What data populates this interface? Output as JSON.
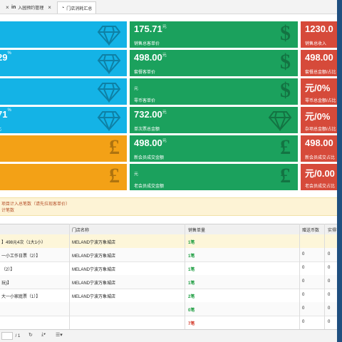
{
  "tabs": [
    {
      "label": "",
      "icon": "x"
    },
    {
      "label": "入园预约管理",
      "icon": "in"
    },
    {
      "label": "门店消耗汇总",
      "icon": "◔"
    }
  ],
  "cards": [
    {
      "color": "blue",
      "value": "",
      "sup": "",
      "unit": "",
      "label": "",
      "icon": "diamond-icon"
    },
    {
      "color": "green",
      "value": "175.71",
      "sup": "元",
      "unit": "",
      "label": "销售总客单价",
      "icon": "dollar-icon"
    },
    {
      "color": "red",
      "value": "1230.0",
      "sup": "",
      "unit": "",
      "label": "销售总收入",
      "icon": ""
    },
    {
      "color": "blue",
      "value": "29",
      "sup": "%",
      "unit": "",
      "label": "",
      "icon": "diamond-icon"
    },
    {
      "color": "green",
      "value": "498.00",
      "sup": "元",
      "unit": "",
      "label": "套餐客单价",
      "icon": "dollar-icon"
    },
    {
      "color": "red",
      "value": "498.00",
      "sup": "",
      "unit": "",
      "label": "套餐总金额/占比",
      "icon": ""
    },
    {
      "color": "blue",
      "value": "",
      "sup": "",
      "unit": "",
      "label": "",
      "icon": "diamond-icon"
    },
    {
      "color": "green",
      "value": "",
      "sup": "",
      "unit": "元",
      "label": "零币客单价",
      "icon": "dollar-icon"
    },
    {
      "color": "red",
      "value": "元/0%",
      "sup": "",
      "unit": "",
      "label": "零币总金额/占比",
      "icon": ""
    },
    {
      "color": "blue",
      "value": "71",
      "sup": "%",
      "unit": "",
      "label": "比",
      "icon": "diamond-icon"
    },
    {
      "color": "green",
      "value": "732.00",
      "sup": "元",
      "unit": "",
      "label": "单次票总金额",
      "icon": "diamond-icon"
    },
    {
      "color": "red",
      "value": "元/0%",
      "sup": "",
      "unit": "",
      "label": "杂项总金额/占比",
      "icon": ""
    },
    {
      "color": "orange",
      "value": "",
      "sup": "",
      "unit": "",
      "label": "",
      "icon": "pound-icon"
    },
    {
      "color": "green",
      "value": "498.00",
      "sup": "元",
      "unit": "",
      "label": "新会员成交金额",
      "icon": "pound-icon"
    },
    {
      "color": "red",
      "value": "498.00",
      "sup": "",
      "unit": "",
      "label": "新会员成交占比",
      "icon": ""
    },
    {
      "color": "orange",
      "value": "",
      "sup": "",
      "unit": "",
      "label": "",
      "icon": "pound-icon"
    },
    {
      "color": "green",
      "value": "",
      "sup": "",
      "unit": "元",
      "label": "老会员成交金额",
      "icon": "pound-icon"
    },
    {
      "color": "red",
      "value": "元/0.00",
      "sup": "",
      "unit": "",
      "label": "老会员成交占比",
      "icon": ""
    }
  ],
  "notice": {
    "line1": "项目计入总笔数（请先拉现客单价）",
    "line2": "计笔数"
  },
  "table": {
    "headers": [
      "",
      "门店名称",
      "销售单量",
      "赠送币数",
      "实得币数"
    ],
    "rows": [
      {
        "name": "】498元4次（1大1小）",
        "store": "MELAND宁波万象城店",
        "count": "1笔",
        "a": "",
        "b": "",
        "color": "g",
        "hl": true
      },
      {
        "name": "一小工作日票（2）】",
        "store": "MELAND宁波万象城店",
        "count": "1笔",
        "a": "0",
        "b": "0",
        "color": "g",
        "hl": false
      },
      {
        "name": "（2）】",
        "store": "MELAND宁波万象城店",
        "count": "1笔",
        "a": "0",
        "b": "0",
        "color": "g",
        "hl": false
      },
      {
        "name": "玩)】",
        "store": "MELAND宁波万象城店",
        "count": "1笔",
        "a": "0",
        "b": "0",
        "color": "g",
        "hl": false
      },
      {
        "name": "大一小家庭票（1）】",
        "store": "MELAND宁波万象城店",
        "count": "2笔",
        "a": "0",
        "b": "0",
        "color": "g",
        "hl": false
      },
      {
        "name": "",
        "store": "",
        "count": "0笔",
        "a": "0",
        "b": "0",
        "color": "g",
        "hl": false
      },
      {
        "name": "",
        "store": "",
        "count": "7笔",
        "a": "0",
        "b": "0",
        "color": "r",
        "hl": false
      }
    ]
  },
  "footer": {
    "page": "/ 1"
  }
}
